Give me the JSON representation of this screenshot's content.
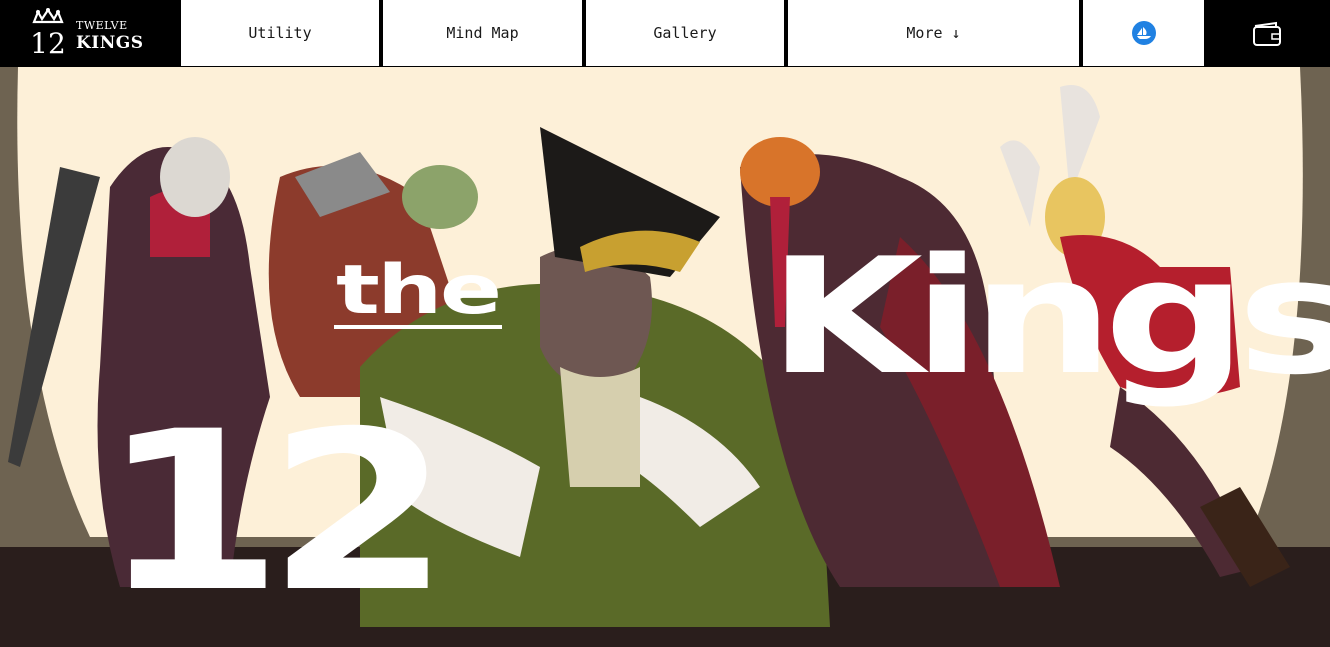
{
  "brand": {
    "logo_number": "12",
    "name_top": "TWELVE",
    "name_bottom": "KINGS",
    "logo_icon": "crown-icon"
  },
  "nav": {
    "items": [
      {
        "label": "Utility"
      },
      {
        "label": "Mind Map"
      },
      {
        "label": "Gallery"
      },
      {
        "label": "More ↓"
      }
    ],
    "opensea_icon": "opensea-icon",
    "wallet_icon": "wallet-icon",
    "opensea_color": "#2081e2"
  },
  "hero": {
    "word_the": "the",
    "word_kings": "Kings",
    "word_number": "12",
    "background_color": "#fdf0d8",
    "illustration": "twelve-kings-characters-artwork"
  }
}
